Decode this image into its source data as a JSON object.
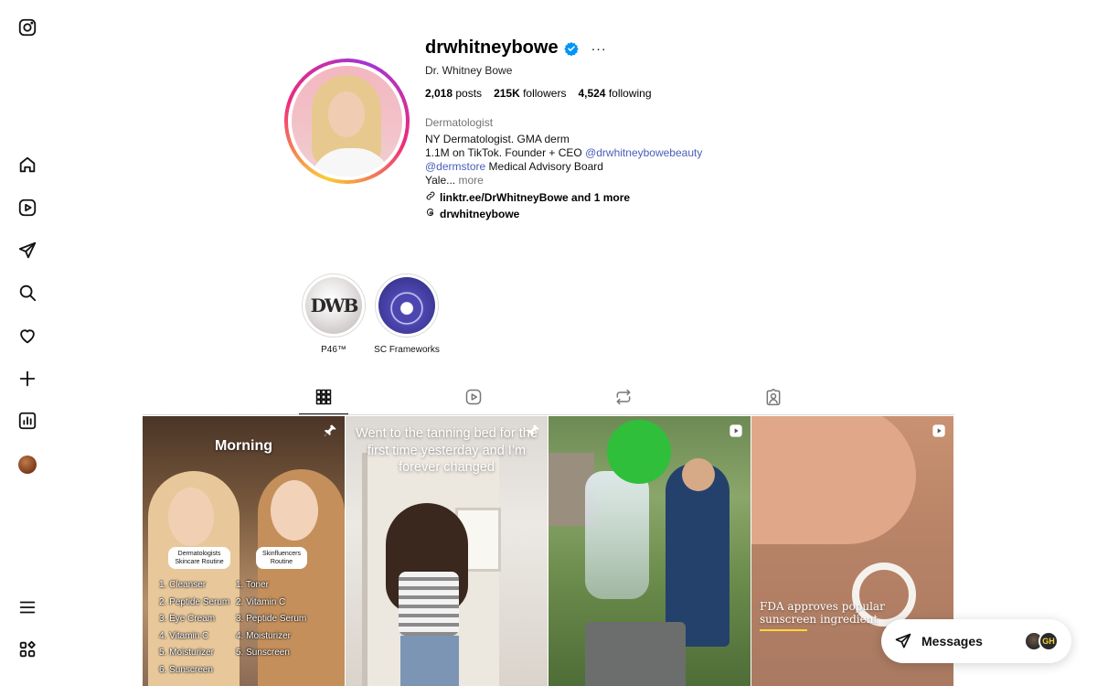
{
  "sidebar": {
    "icons": [
      "instagram-icon",
      "home-icon",
      "reels-icon",
      "direct-icon",
      "search-icon",
      "heart-icon",
      "create-icon",
      "insights-icon",
      "profile-avatar",
      "menu-icon",
      "more-apps-icon"
    ]
  },
  "profile": {
    "username": "drwhitneybowe",
    "full_name": "Dr. Whitney Bowe",
    "more": "···",
    "stats": {
      "posts_count": "2,018",
      "posts_label": "posts",
      "followers_count": "215K",
      "followers_label": "followers",
      "following_count": "4,524",
      "following_label": "following"
    },
    "category": "Dermatologist",
    "bio": {
      "line1": "NY Dermatologist. GMA derm",
      "line2_prefix": "1.1M on TikTok. Founder + CEO ",
      "line2_mention": "@drwhitneybowebeauty",
      "line3_mention": "@dermstore",
      "line3_suffix": " Medical Advisory Board",
      "line4_prefix": "Yale... ",
      "line4_more": "more"
    },
    "link": "linktr.ee/DrWhitneyBowe and 1 more",
    "threads": "drwhitneybowe"
  },
  "highlights": [
    {
      "label": "P46™",
      "logo_text": "DWB"
    },
    {
      "label": "SC Frameworks"
    }
  ],
  "tabs": [
    "posts-grid",
    "reels",
    "reposts",
    "tagged"
  ],
  "posts": [
    {
      "type": "pinned",
      "title": "Morning",
      "box_a": "Dermatologists Skincare Routine",
      "box_b": "Skinfluencers Routine",
      "list_a": [
        "1. Cleanser",
        "2. Peptide Serum",
        "3. Eye Cream",
        "4. Vitamin C",
        "5. Moisturizer",
        "6. Sunscreen"
      ],
      "list_b": [
        "1. Toner",
        "2. Vitamin C",
        "3. Peptide Serum",
        "4. Moisturizer",
        "5. Sunscreen"
      ]
    },
    {
      "type": "pinned",
      "text": "Went to the tanning bed for the first time yesterday and I’m forever changed"
    },
    {
      "type": "reel"
    },
    {
      "type": "reel",
      "text": "FDA approves popular sunscreen ingredient"
    }
  ],
  "messages": {
    "label": "Messages",
    "avatar_b_initials": "GH"
  },
  "colors": {
    "verified": "#0095f6",
    "link_blue": "#4a5dbb",
    "muted": "#737373",
    "p4_accent": "#ffd43b"
  }
}
